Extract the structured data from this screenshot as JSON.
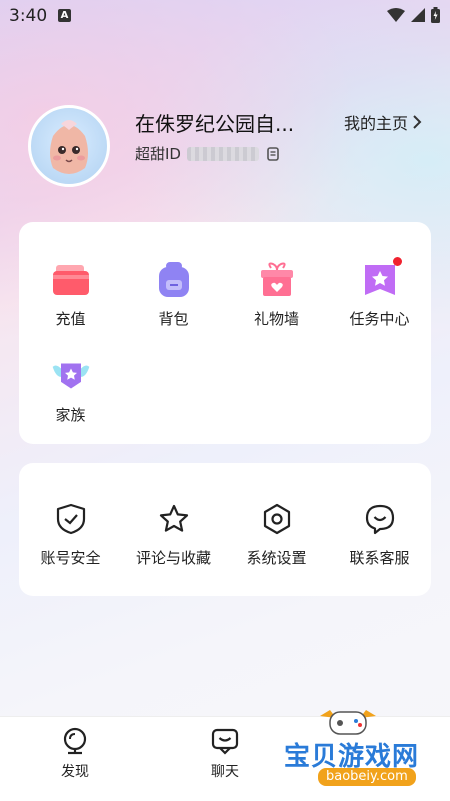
{
  "status_bar": {
    "time": "3:40",
    "notif_icon_letter": "A"
  },
  "profile": {
    "nickname": "在侏罗纪公园自...",
    "id_label": "超甜ID",
    "homepage_link": "我的主页"
  },
  "card_main": {
    "items": [
      {
        "label": "充值",
        "icon": "recharge-wallet-icon"
      },
      {
        "label": "背包",
        "icon": "backpack-icon"
      },
      {
        "label": "礼物墙",
        "icon": "gift-box-icon"
      },
      {
        "label": "任务中心",
        "icon": "task-flag-icon",
        "has_badge": true
      },
      {
        "label": "家族",
        "icon": "family-badge-icon"
      }
    ]
  },
  "card_settings": {
    "items": [
      {
        "label": "账号安全",
        "icon": "shield-check-icon"
      },
      {
        "label": "评论与收藏",
        "icon": "star-icon"
      },
      {
        "label": "系统设置",
        "icon": "settings-hexagon-icon"
      },
      {
        "label": "联系客服",
        "icon": "customer-service-icon"
      }
    ]
  },
  "tabbar": {
    "tabs": [
      {
        "label": "发现",
        "icon": "discover-icon"
      },
      {
        "label": "聊天",
        "icon": "chat-icon"
      }
    ]
  },
  "watermark": {
    "text": "宝贝游戏网",
    "url": "baobeiy.com"
  },
  "colors": {
    "accent_red_dot": "#f0222f",
    "watermark_blue": "#2a7bd8",
    "watermark_orange": "#f1a21b"
  }
}
